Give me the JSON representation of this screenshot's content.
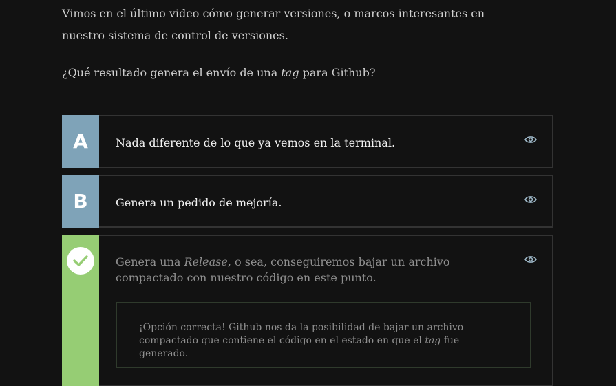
{
  "intro": {
    "text": "Vimos en el último video cómo generar versiones, o marcos interesantes en nuestro sistema de control de versiones."
  },
  "question": {
    "before": "¿Qué resultado genera el envío de una ",
    "italic": "tag",
    "after": " para Github?"
  },
  "options": [
    {
      "letter": "A",
      "text": "Nada diferente de lo que ya vemos en la terminal."
    },
    {
      "letter": "B",
      "text": "Genera un pedido de mejoría."
    },
    {
      "letter": "",
      "text_before": "Genera una ",
      "text_italic": "Release",
      "text_after": ", o sea, conseguiremos bajar un archivo compactado con nuestro código en este punto.",
      "correct": true,
      "feedback": {
        "before": "¡Opción correcta! Github nos da la posibilidad de bajar un archivo compactado que contiene el código en el estado en que el ",
        "italic": "tag",
        "after": " fue generado."
      }
    }
  ],
  "icons": {
    "reveal": "eye-icon",
    "correct": "checkmark-icon"
  },
  "colors": {
    "background": "#121212",
    "option_letter_bg": "#7fa3b8",
    "correct_bg": "#96cd74",
    "border": "#333333"
  }
}
